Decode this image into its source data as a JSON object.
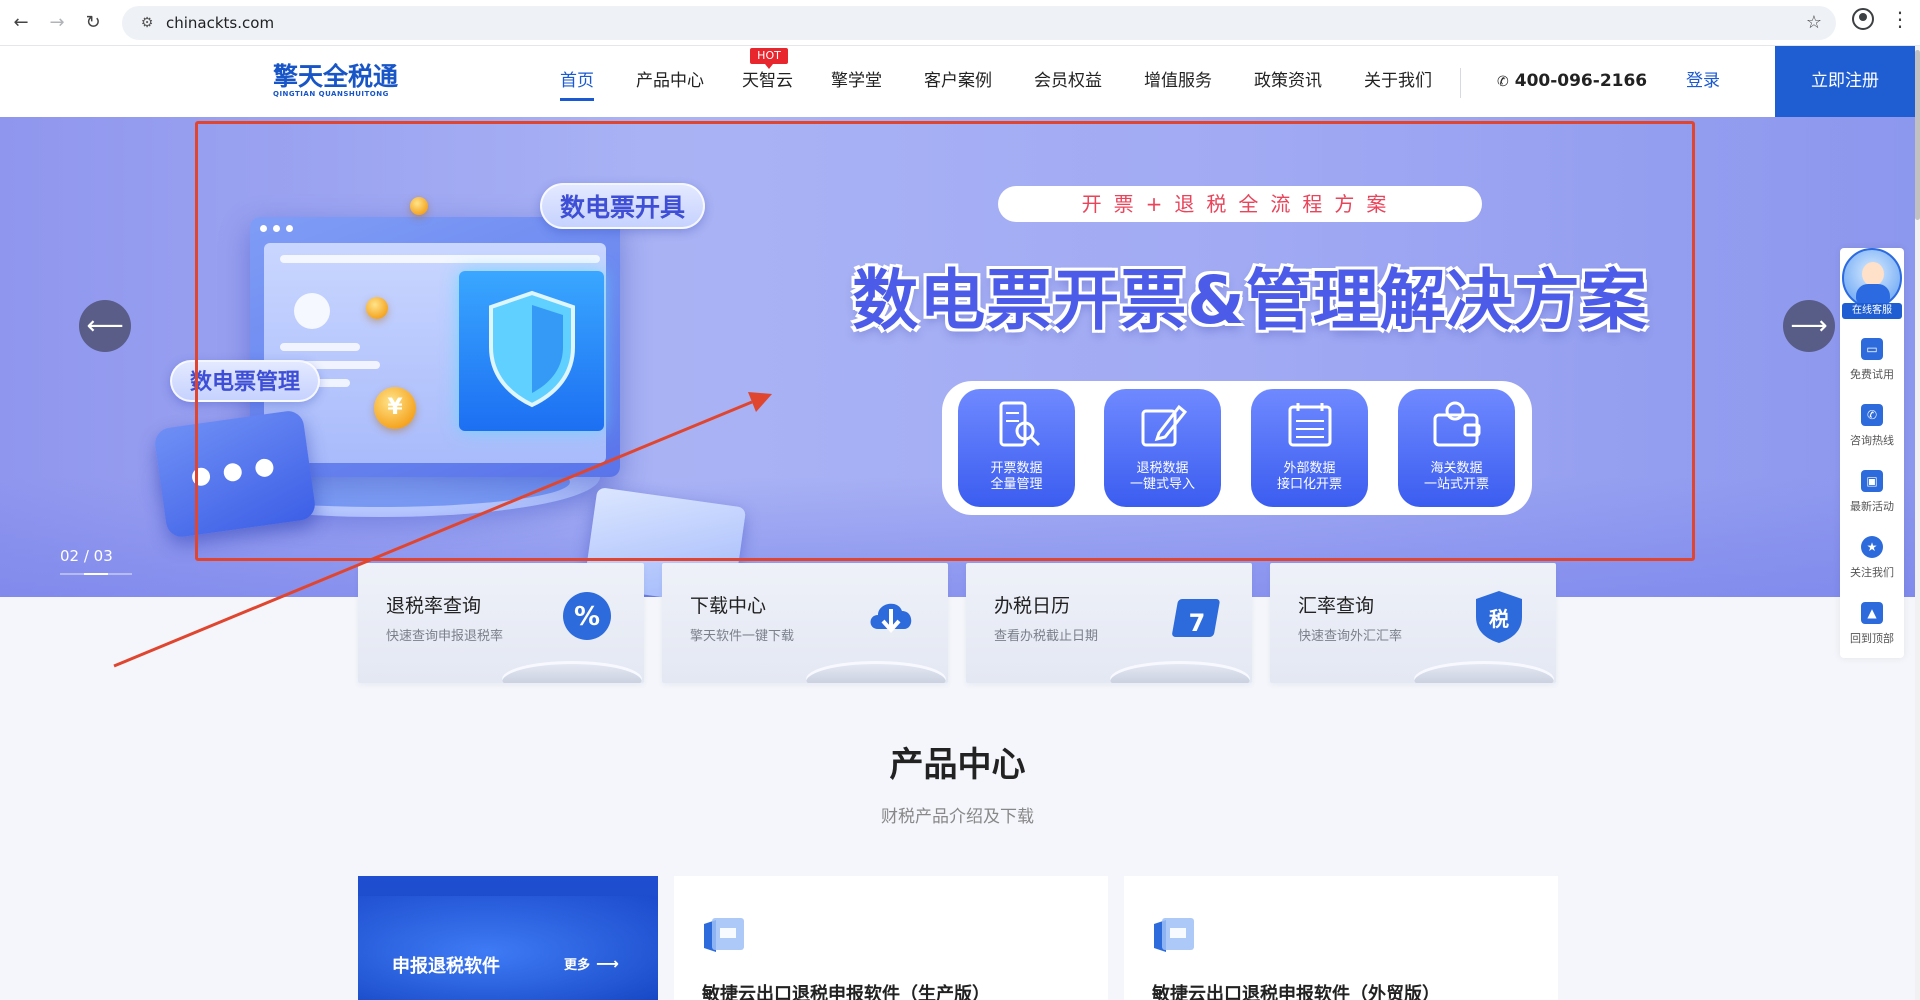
{
  "browser": {
    "url": "chinackts.com",
    "back_icon": "←",
    "forward_icon": "→",
    "reload_icon": "↻"
  },
  "header": {
    "logo_cn": "擎天全税通",
    "logo_en": "QINGTIAN QUANSHUITONG",
    "menu": [
      {
        "label": "首页",
        "active": true
      },
      {
        "label": "产品中心"
      },
      {
        "label": "天智云",
        "badge": "HOT"
      },
      {
        "label": "擎学堂"
      },
      {
        "label": "客户案例"
      },
      {
        "label": "会员权益"
      },
      {
        "label": "增值服务"
      },
      {
        "label": "政策资讯"
      },
      {
        "label": "关于我们"
      }
    ],
    "phone": "400-096-2166",
    "login": "登录",
    "register": "立即注册"
  },
  "hero": {
    "subtitle": "开票+退税全流程方案",
    "title": "数电票开票&管理解决方案",
    "tag_issue": "数电票开具",
    "tag_manage": "数电票管理",
    "coin_symbol": "¥",
    "pager": "02 / 03",
    "prev_arrow": "⟵",
    "next_arrow": "⟶",
    "features": [
      {
        "line1": "开票数据",
        "line2": "全量管理"
      },
      {
        "line1": "退税数据",
        "line2": "一键式导入"
      },
      {
        "line1": "外部数据",
        "line2": "接口化开票"
      },
      {
        "line1": "海关数据",
        "line2": "一站式开票"
      }
    ]
  },
  "sidebar": {
    "online": "在线客服",
    "items": [
      {
        "label": "免费试用"
      },
      {
        "label": "咨询热线"
      },
      {
        "label": "最新活动"
      },
      {
        "label": "关注我们"
      },
      {
        "label": "回到顶部"
      }
    ]
  },
  "quick_links": [
    {
      "title": "退税率查询",
      "desc": "快速查询申报退税率",
      "icon": "%"
    },
    {
      "title": "下载中心",
      "desc": "擎天软件一键下载",
      "icon": "download"
    },
    {
      "title": "办税日历",
      "desc": "查看办税截止日期",
      "icon": "7"
    },
    {
      "title": "汇率查询",
      "desc": "快速查询外汇汇率",
      "icon": "税"
    }
  ],
  "products": {
    "title": "产品中心",
    "subtitle": "财税产品介绍及下载",
    "category": "申报退税软件",
    "more": "更多",
    "cards": [
      {
        "title": "敏捷云出口退税申报软件（生产版）"
      },
      {
        "title": "敏捷云出口退税申报软件（外贸版）"
      }
    ]
  },
  "colors": {
    "brand": "#1f5ed2",
    "annotation": "#e0462f",
    "hot": "#e8262d"
  }
}
